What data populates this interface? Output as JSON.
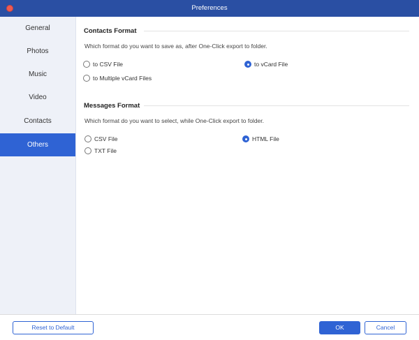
{
  "window": {
    "title": "Preferences"
  },
  "sidebar": {
    "items": [
      {
        "label": "General",
        "active": false
      },
      {
        "label": "Photos",
        "active": false
      },
      {
        "label": "Music",
        "active": false
      },
      {
        "label": "Video",
        "active": false
      },
      {
        "label": "Contacts",
        "active": false
      },
      {
        "label": "Others",
        "active": true
      }
    ]
  },
  "contacts_format": {
    "title": "Contacts Format",
    "description": "Which format do you want to save as, after One-Click export to folder.",
    "options": [
      {
        "label": "to CSV File",
        "checked": false
      },
      {
        "label": "to vCard File",
        "checked": true
      },
      {
        "label": "to Multiple vCard Files",
        "checked": false
      }
    ]
  },
  "messages_format": {
    "title": "Messages Format",
    "description": "Which format do you want to select, while One-Click export to folder.",
    "options": [
      {
        "label": "CSV File",
        "checked": false
      },
      {
        "label": "HTML File",
        "checked": true
      },
      {
        "label": "TXT File",
        "checked": false
      }
    ]
  },
  "footer": {
    "reset_label": "Reset to Default",
    "ok_label": "OK",
    "cancel_label": "Cancel"
  },
  "colors": {
    "titlebar": "#2a4fa3",
    "accent": "#2f63d4",
    "sidebar_bg": "#eef1f8"
  }
}
